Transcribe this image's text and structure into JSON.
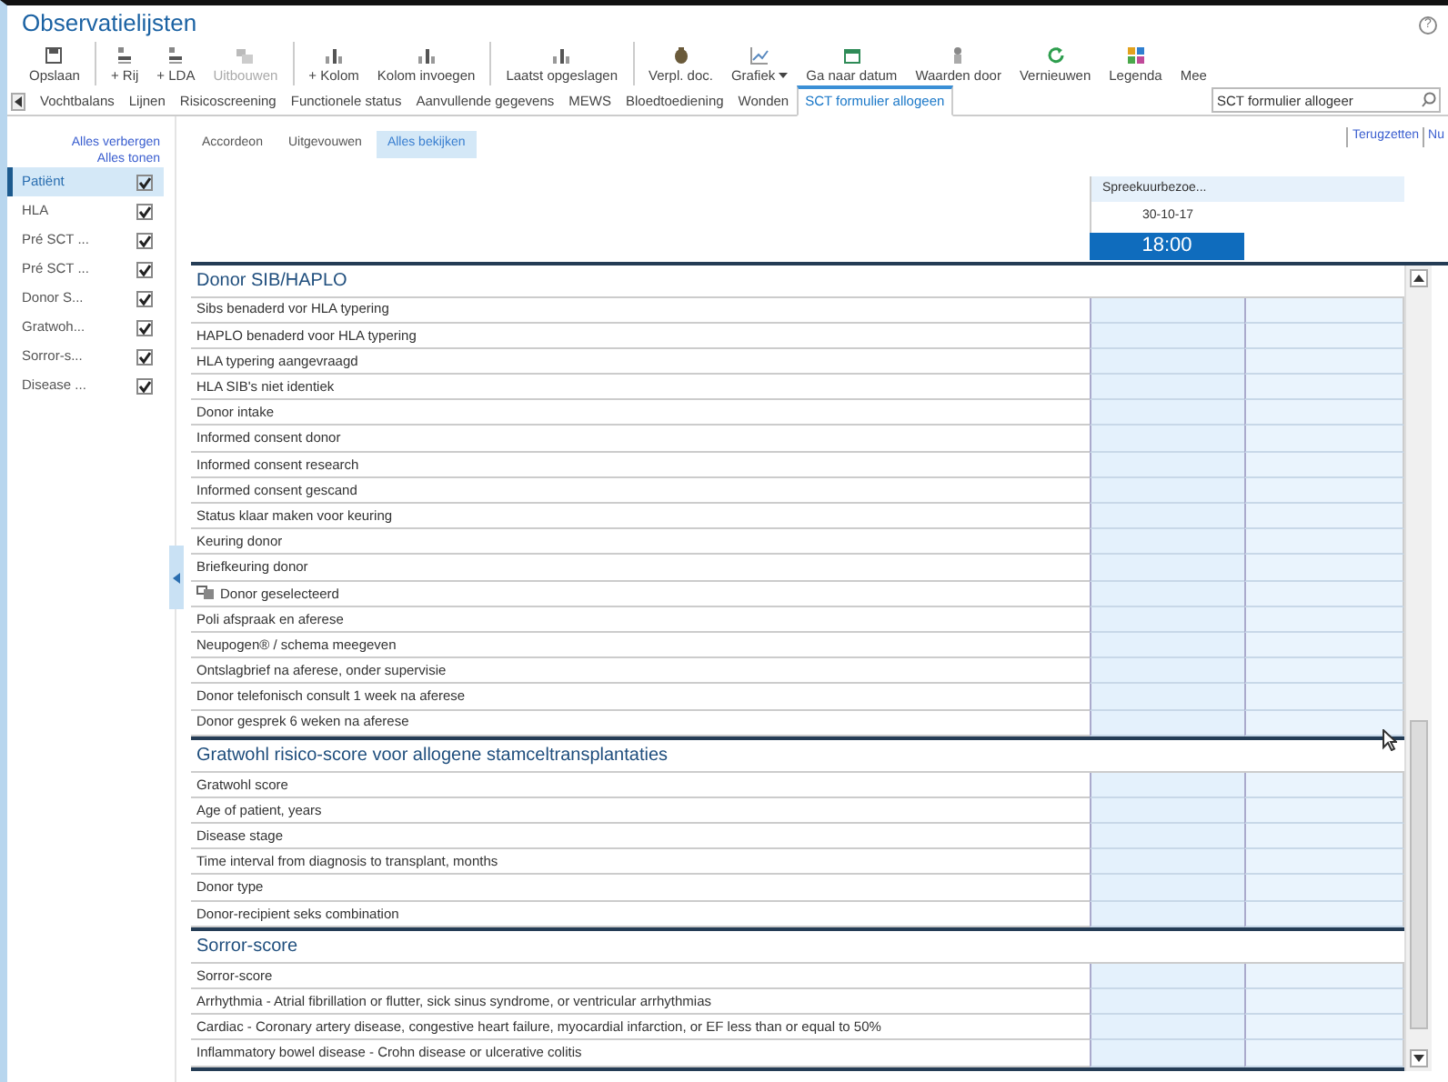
{
  "window": {
    "title": "Observatielijsten",
    "help": "?"
  },
  "toolbar": {
    "groups": [
      [
        {
          "label": "Opslaan",
          "disabled": false,
          "dropdown": false
        }
      ],
      [
        {
          "label": "+ Rij",
          "disabled": false,
          "dropdown": false
        },
        {
          "label": "+ LDA",
          "disabled": false,
          "dropdown": false
        },
        {
          "label": "Uitbouwen",
          "disabled": true,
          "dropdown": false
        }
      ],
      [
        {
          "label": "+ Kolom",
          "disabled": false,
          "dropdown": false
        },
        {
          "label": "Kolom invoegen",
          "disabled": false,
          "dropdown": false
        }
      ],
      [
        {
          "label": "Laatst opgeslagen",
          "disabled": false,
          "dropdown": false
        }
      ],
      [
        {
          "label": "Verpl. doc.",
          "disabled": false,
          "dropdown": false
        },
        {
          "label": "Grafiek",
          "disabled": false,
          "dropdown": true
        },
        {
          "label": "Ga naar datum",
          "disabled": false,
          "dropdown": false
        },
        {
          "label": "Waarden door",
          "disabled": false,
          "dropdown": false
        },
        {
          "label": "Vernieuwen",
          "disabled": false,
          "dropdown": false
        },
        {
          "label": "Legenda",
          "disabled": false,
          "dropdown": false
        },
        {
          "label": "Mee",
          "disabled": false,
          "dropdown": false
        }
      ]
    ]
  },
  "tabs": [
    {
      "label": "Vochtbalans",
      "selected": false
    },
    {
      "label": "Lijnen",
      "selected": false
    },
    {
      "label": "Risicoscreening",
      "selected": false
    },
    {
      "label": "Functionele status",
      "selected": false
    },
    {
      "label": "Aanvullende gegevens",
      "selected": false
    },
    {
      "label": "MEWS",
      "selected": false
    },
    {
      "label": "Bloedtoediening",
      "selected": false
    },
    {
      "label": "Wonden",
      "selected": false
    },
    {
      "label": "SCT formulier allogeen",
      "selected": true
    }
  ],
  "search": {
    "value": "SCT formulier allogeer"
  },
  "sidebar": {
    "links": [
      "Alles verbergen",
      "Alles tonen"
    ],
    "items": [
      {
        "label": "Patiënt",
        "checked": true,
        "selected": true
      },
      {
        "label": "HLA",
        "checked": true,
        "selected": false
      },
      {
        "label": "Pré SCT ...",
        "checked": true,
        "selected": false
      },
      {
        "label": "Pré SCT ...",
        "checked": true,
        "selected": false
      },
      {
        "label": "Donor S...",
        "checked": true,
        "selected": false
      },
      {
        "label": "Gratwoh...",
        "checked": true,
        "selected": false
      },
      {
        "label": "Sorror-s...",
        "checked": true,
        "selected": false
      },
      {
        "label": "Disease ...",
        "checked": true,
        "selected": false
      }
    ]
  },
  "views": [
    {
      "label": "Accordeon",
      "selected": false
    },
    {
      "label": "Uitgevouwen",
      "selected": false
    },
    {
      "label": "Alles bekijken",
      "selected": true
    }
  ],
  "nav_links": [
    "Terugzetten",
    "Nu"
  ],
  "column": {
    "visit": "Spreekuurbezoe...",
    "date": "30-10-17",
    "time": "18:00"
  },
  "sections": [
    {
      "title": "Donor SIB/HAPLO",
      "rows": [
        {
          "label": "Sibs benaderd vor HLA typering",
          "kind": "plain"
        },
        {
          "label": "HAPLO benaderd voor HLA typering",
          "kind": "plain"
        },
        {
          "label": "HLA typering aangevraagd",
          "kind": "plain"
        },
        {
          "label": "HLA SIB's niet identiek",
          "kind": "plain"
        },
        {
          "label": "Donor intake",
          "kind": "plain"
        },
        {
          "label": "Informed consent donor",
          "kind": "plain"
        },
        {
          "label": "Informed consent research",
          "kind": "plain"
        },
        {
          "label": "Informed consent gescand",
          "kind": "plain"
        },
        {
          "label": "Status klaar maken voor keuring",
          "kind": "plain"
        },
        {
          "label": "Keuring donor",
          "kind": "plain"
        },
        {
          "label": "Briefkeuring donor",
          "kind": "plain"
        },
        {
          "label": "Donor geselecteerd",
          "kind": "linked"
        },
        {
          "label": "Poli afspraak en aferese",
          "kind": "plain"
        },
        {
          "label": "Neupogen® / schema meegeven",
          "kind": "plain"
        },
        {
          "label": "Ontslagbrief na aferese, onder supervisie",
          "kind": "plain"
        },
        {
          "label": "Donor telefonisch consult 1 week na aferese",
          "kind": "plain"
        },
        {
          "label": "Donor gesprek 6 weken na aferese",
          "kind": "plain"
        }
      ]
    },
    {
      "title": "Gratwohl risico-score voor allogene stamceltransplantaties",
      "rows": [
        {
          "label": "Gratwohl score",
          "kind": "plain"
        },
        {
          "label": "Age of patient, years",
          "kind": "plain"
        },
        {
          "label": "Disease stage",
          "kind": "plain"
        },
        {
          "label": "Time interval from diagnosis to transplant, months",
          "kind": "plain"
        },
        {
          "label": "Donor type",
          "kind": "plain"
        },
        {
          "label": "Donor-recipient seks combination",
          "kind": "plain"
        }
      ]
    },
    {
      "title": "Sorror-score",
      "rows": [
        {
          "label": "Sorror-score",
          "kind": "plain"
        },
        {
          "label": "Arrhythmia - Atrial fibrillation or flutter, sick sinus syndrome, or ventricular arrhythmias",
          "kind": "plain"
        },
        {
          "label": "Cardiac - Coronary artery disease, congestive heart failure, myocardial infarction, or EF less than or equal to 50%",
          "kind": "plain"
        },
        {
          "label": "Inflammatory bowel disease - Crohn disease or ulcerative colitis",
          "kind": "plain"
        }
      ]
    }
  ]
}
